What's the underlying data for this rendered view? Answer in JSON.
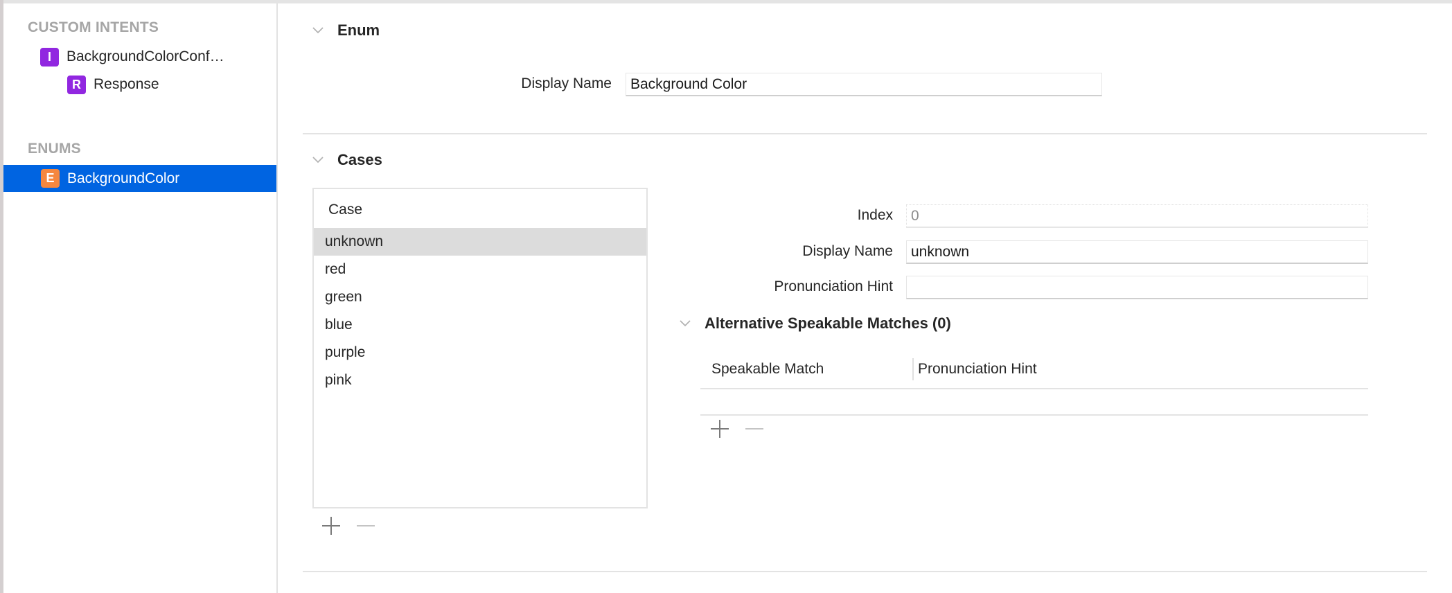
{
  "sidebar": {
    "sections": [
      {
        "title": "CUSTOM INTENTS",
        "items": [
          {
            "badge": "I",
            "badge_color": "#9127e0",
            "label": "BackgroundColorConf…",
            "selected": false
          },
          {
            "badge": "R",
            "badge_color": "#9127e0",
            "label": "Response",
            "selected": false
          }
        ]
      },
      {
        "title": "ENUMS",
        "items": [
          {
            "badge": "E",
            "badge_color": "#f5873f",
            "label": "BackgroundColor",
            "selected": true
          }
        ]
      }
    ],
    "selection_color": "#0064e1"
  },
  "enum_section": {
    "title": "Enum",
    "display_name_label": "Display Name",
    "display_name_value": "Background Color"
  },
  "cases_section": {
    "title": "Cases",
    "table_header": "Case",
    "cases": [
      "unknown",
      "red",
      "green",
      "blue",
      "purple",
      "pink"
    ],
    "selected_index": 0,
    "add_icon": "plus-icon",
    "remove_icon": "minus-icon"
  },
  "case_detail": {
    "index_label": "Index",
    "index_value": "0",
    "display_name_label": "Display Name",
    "display_name_value": "unknown",
    "pronunciation_hint_label": "Pronunciation Hint",
    "pronunciation_hint_value": ""
  },
  "alt_matches": {
    "title": "Alternative Speakable Matches (0)",
    "columns": [
      "Speakable Match",
      "Pronunciation Hint"
    ],
    "rows": [],
    "add_icon": "plus-icon",
    "remove_icon": "minus-icon"
  }
}
